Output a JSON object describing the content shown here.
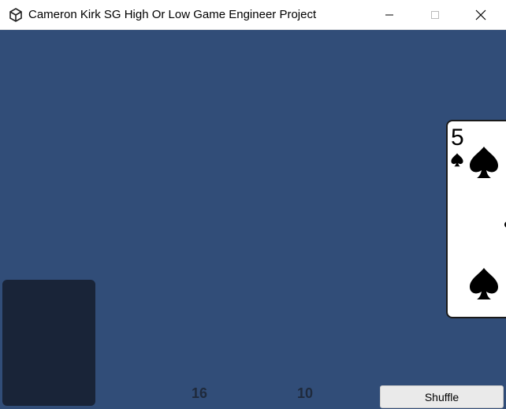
{
  "window": {
    "title": "Cameron Kirk SG High Or Low Game Engineer Project",
    "icons": {
      "app": "unity-logo-icon",
      "minimize": "minimize-icon",
      "maximize": "maximize-icon",
      "close": "close-icon"
    }
  },
  "game": {
    "background_color": "#314d78",
    "deck_slot_color": "#192438",
    "card": {
      "rank": "5",
      "suit": "spades",
      "suit_icon": "spade-icon"
    },
    "scores": [
      "16",
      "10"
    ],
    "shuffle_label": "Shuffle"
  }
}
